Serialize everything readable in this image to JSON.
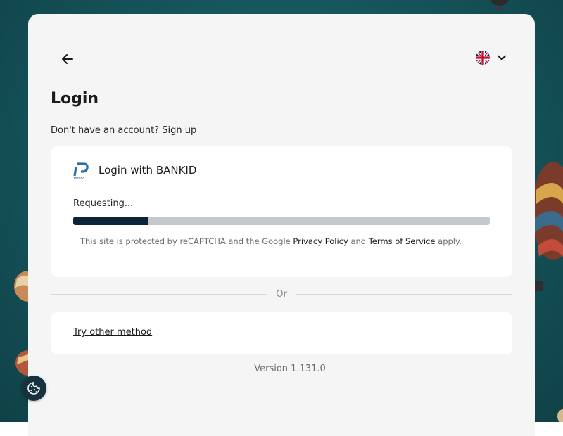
{
  "header": {
    "back_icon": "arrow-left-icon",
    "language": {
      "icon": "uk-flag-icon",
      "chevron": "chevron-down-icon"
    }
  },
  "login": {
    "title": "Login",
    "no_account_text": "Don't have an account?",
    "signup_label": "Sign up"
  },
  "bankid": {
    "logo_icon": "bankid-logo-icon",
    "title": "Login with BANKID",
    "status": "Requesting...",
    "progress": 0.18,
    "recaptcha": {
      "prefix": "This site is protected by reCAPTCHA and the Google",
      "privacy_label": "Privacy Policy",
      "and": "and",
      "terms_label": "Terms of Service",
      "suffix": "apply."
    }
  },
  "divider": {
    "label": "Or"
  },
  "other": {
    "label": "Try other method"
  },
  "footer": {
    "version": "Version 1.131.0"
  },
  "cookie": {
    "icon": "cookie-icon"
  },
  "colors": {
    "background": "#1b5f66",
    "card": "#f5f5f5",
    "progress_fill": "#0c2436",
    "progress_track": "#c3c9cd",
    "cookie_button": "#17323e"
  }
}
